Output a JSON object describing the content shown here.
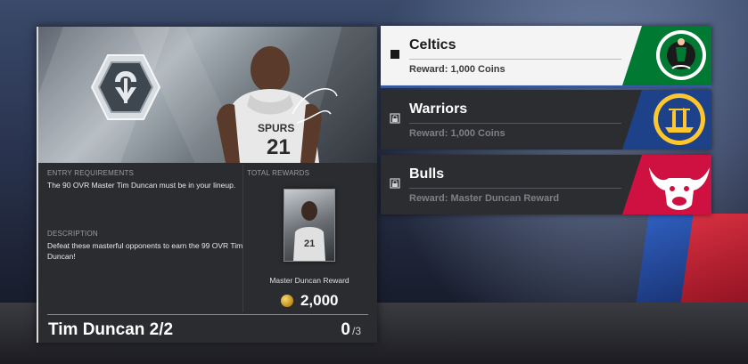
{
  "challenge": {
    "entry_label": "ENTRY REQUIREMENTS",
    "entry_text": "The 90 OVR Master Tim Duncan must be in your lineup.",
    "description_label": "DESCRIPTION",
    "description_text": "Defeat these masterful opponents to earn the 99 OVR Tim Duncan!",
    "total_rewards_label": "TOTAL REWARDS",
    "reward_card_name": "Master Duncan Reward",
    "coins": "2,000",
    "title": "Tim Duncan 2/2",
    "progress_done": "0",
    "progress_total": "/3",
    "player_number": "21"
  },
  "opponents": [
    {
      "team": "Celtics",
      "reward": "Reward: 1,000 Coins",
      "status": "active",
      "logo": "celtics-logo",
      "color": "#007a33",
      "logo_text": "BOSTON CELTICS"
    },
    {
      "team": "Warriors",
      "reward": "Reward: 1,000 Coins",
      "status": "locked",
      "logo": "warriors-logo",
      "color": "#1d428a"
    },
    {
      "team": "Bulls",
      "reward": "Reward: Master Duncan Reward",
      "status": "locked",
      "logo": "bulls-logo",
      "color": "#ce1141"
    }
  ]
}
